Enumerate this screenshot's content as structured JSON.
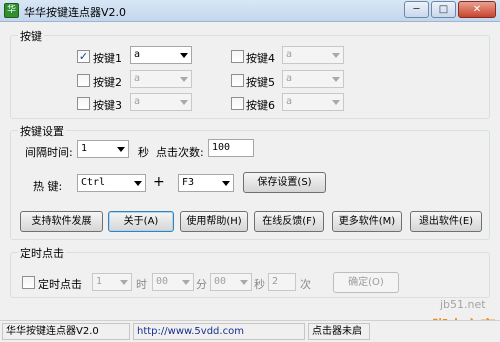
{
  "window": {
    "title": "华华按键连点器V2.0",
    "icon_text": "华",
    "minimize_label": "─",
    "maximize_label": "□",
    "close_label": "✕"
  },
  "keys_group": {
    "title": "按键",
    "keys": [
      {
        "label": "按键1",
        "checked": true,
        "value": "a"
      },
      {
        "label": "按键2",
        "checked": false,
        "value": "a"
      },
      {
        "label": "按键3",
        "checked": false,
        "value": "a"
      },
      {
        "label": "按键4",
        "checked": false,
        "value": "a"
      },
      {
        "label": "按键5",
        "checked": false,
        "value": "a"
      },
      {
        "label": "按键6",
        "checked": false,
        "value": "a"
      }
    ]
  },
  "settings_group": {
    "title": "按键设置",
    "interval_label": "间隔时间:",
    "interval_value": "1",
    "sec_label": "秒",
    "count_label": "点击次数:",
    "count_value": "100",
    "hotkey_label": "热  键:",
    "hotkey_mod": "Ctrl",
    "plus": "+",
    "hotkey_key": "F3",
    "save_button": "保存设置(S)"
  },
  "actions": {
    "support": "支持软件发展",
    "about": "关于(A)",
    "help": "使用帮助(H)",
    "feedback": "在线反馈(F)",
    "more": "更多软件(M)",
    "exit": "退出软件(E)"
  },
  "timer_group": {
    "title": "定时点击",
    "checkbox_label": "定时点击",
    "hour_value": "1",
    "hour_unit": "时",
    "minute_value": "00",
    "minute_unit": "分",
    "second_value": "00",
    "second_unit": "秒",
    "count_value": "2",
    "count_unit": "次",
    "confirm_button": "确定(O)"
  },
  "statusbar": {
    "app": "华华按键连点器V2.0",
    "url": "http://www.5vdd.com",
    "status": "点击器未启"
  },
  "watermark": {
    "line1": "jb51.net",
    "line2": "脚本之家"
  }
}
